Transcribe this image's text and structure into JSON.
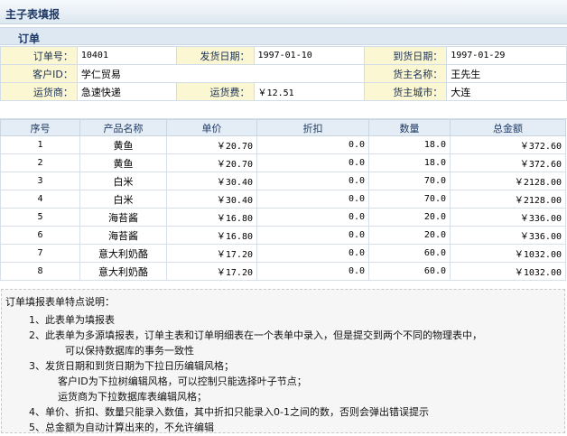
{
  "page": {
    "title": "主子表填报"
  },
  "order": {
    "section_title": "订单",
    "fields": {
      "order_no_label": "订单号：",
      "order_no": "10401",
      "ship_date_label": "发货日期：",
      "ship_date": "1997-01-10",
      "arrive_date_label": "到货日期：",
      "arrive_date": "1997-01-29",
      "customer_id_label": "客户ID：",
      "customer_id": "学仁贸易",
      "consignee_label": "货主名称：",
      "consignee": "王先生",
      "shipper_label": "运货商：",
      "shipper": "急速快递",
      "freight_label": "运货费：",
      "freight": "￥12.51",
      "ship_city_label": "货主城市：",
      "ship_city": "大连"
    }
  },
  "details": {
    "headers": [
      "序号",
      "产品名称",
      "单价",
      "折扣",
      "数量",
      "总金额"
    ],
    "rows": [
      {
        "no": "1",
        "product": "黄鱼",
        "price": "￥20.70",
        "discount": "0.0",
        "qty": "18.0",
        "total": "￥372.60"
      },
      {
        "no": "2",
        "product": "黄鱼",
        "price": "￥20.70",
        "discount": "0.0",
        "qty": "18.0",
        "total": "￥372.60"
      },
      {
        "no": "3",
        "product": "白米",
        "price": "￥30.40",
        "discount": "0.0",
        "qty": "70.0",
        "total": "￥2128.00"
      },
      {
        "no": "4",
        "product": "白米",
        "price": "￥30.40",
        "discount": "0.0",
        "qty": "70.0",
        "total": "￥2128.00"
      },
      {
        "no": "5",
        "product": "海苔酱",
        "price": "￥16.80",
        "discount": "0.0",
        "qty": "20.0",
        "total": "￥336.00"
      },
      {
        "no": "6",
        "product": "海苔酱",
        "price": "￥16.80",
        "discount": "0.0",
        "qty": "20.0",
        "total": "￥336.00"
      },
      {
        "no": "7",
        "product": "意大利奶酪",
        "price": "￥17.20",
        "discount": "0.0",
        "qty": "60.0",
        "total": "￥1032.00"
      },
      {
        "no": "8",
        "product": "意大利奶酪",
        "price": "￥17.20",
        "discount": "0.0",
        "qty": "60.0",
        "total": "￥1032.00"
      }
    ]
  },
  "notes": {
    "title": "订单填报表单特点说明：",
    "lines": [
      "1、此表单为填报表",
      "2、此表单为多源填报表，订单主表和订单明细表在一个表单中录入，但是提交到两个不同的物理表中，",
      "可以保持数据库的事务一致性",
      "3、发货日期和到货日期为下拉日历编辑风格；",
      "客户ID为下拉树编辑风格，可以控制只能选择叶子节点；",
      "运货商为下拉数据库表编辑风格；",
      "4、单价、折扣、数量只能录入数值，其中折扣只能录入0-1之间的数，否则会弹出错误提示",
      "5、总金额为自动计算出来的，不允许编辑"
    ]
  }
}
